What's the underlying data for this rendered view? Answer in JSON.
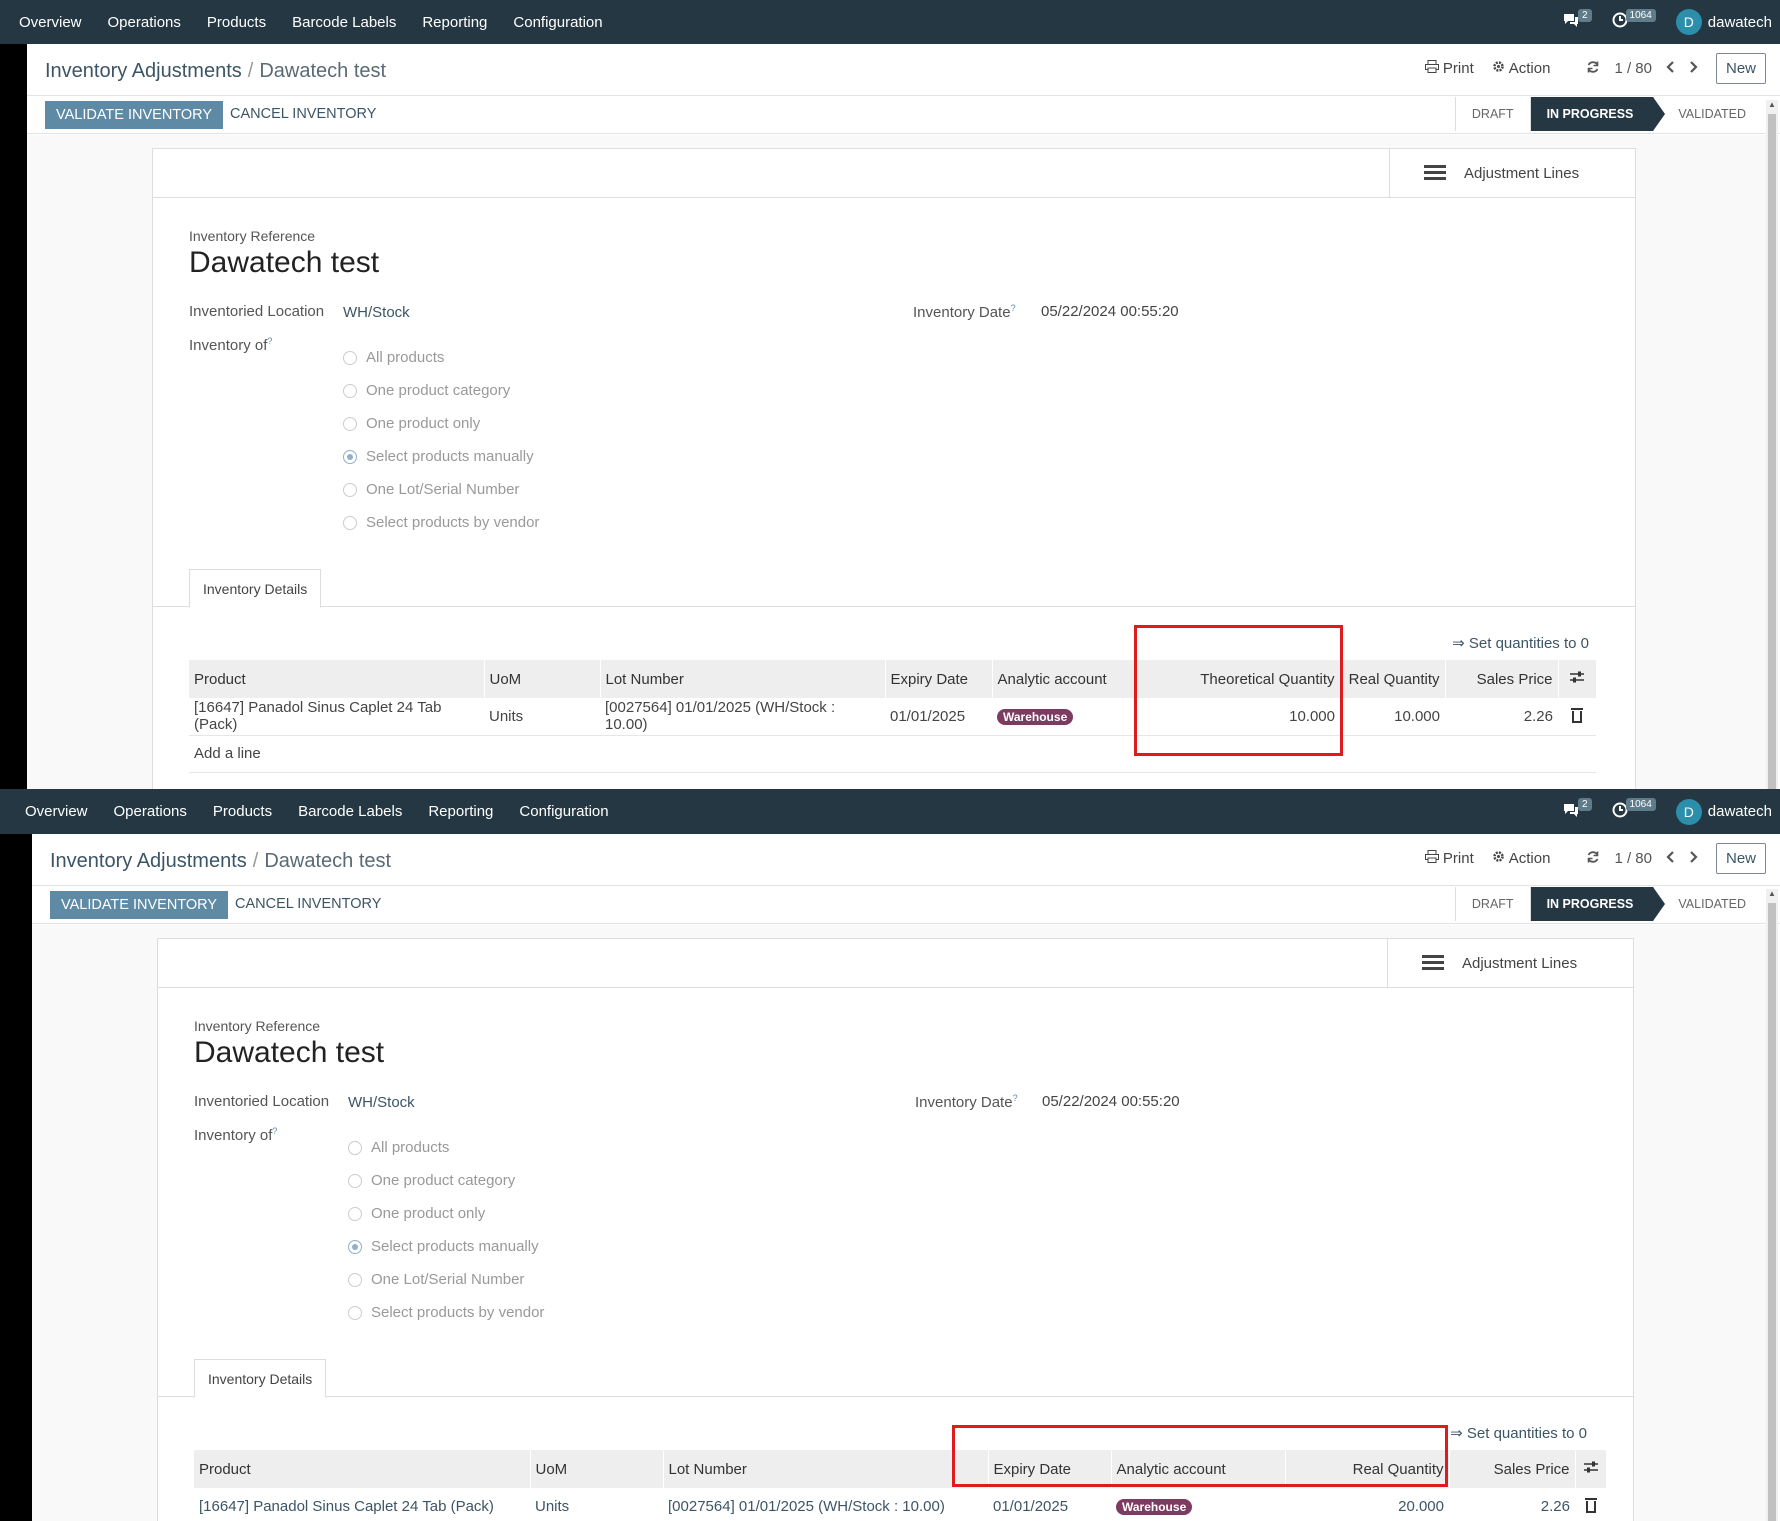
{
  "navbar": {
    "menu": [
      "Overview",
      "Operations",
      "Products",
      "Barcode Labels",
      "Reporting",
      "Configuration"
    ],
    "messages_count": "2",
    "activities_count": "1064",
    "user_initial": "D",
    "user_name": "dawatech"
  },
  "control_panel": {
    "breadcrumb_parent": "Inventory Adjustments",
    "breadcrumb_sep": "/",
    "breadcrumb_current": "Dawatech test",
    "print_label": "Print",
    "action_label": "Action",
    "pager": "1 / 80",
    "new_label": "New"
  },
  "statusbar": {
    "validate_label": "VALIDATE INVENTORY",
    "cancel_label": "CANCEL INVENTORY",
    "states": [
      "DRAFT",
      "IN PROGRESS",
      "VALIDATED"
    ],
    "active_state": "IN PROGRESS"
  },
  "form": {
    "smart_button": "Adjustment Lines",
    "reference_label": "Inventory Reference",
    "title": "Dawatech test",
    "location_label": "Inventoried Location",
    "location_value": "WH/Stock",
    "date_label": "Inventory Date",
    "date_help": "?",
    "date_value": "05/22/2024 00:55:20",
    "inventory_of_label": "Inventory of",
    "inventory_of_help": "?",
    "inventory_of_options": [
      "All products",
      "One product category",
      "One product only",
      "Select products manually",
      "One Lot/Serial Number",
      "Select products by vendor"
    ],
    "inventory_of_selected": "Select products manually",
    "tab_label": "Inventory Details",
    "set_quantities": "⇒ Set quantities to 0",
    "add_line": "Add a line"
  },
  "table_top": {
    "headers": [
      "Product",
      "UoM",
      "Lot Number",
      "Expiry Date",
      "Analytic account",
      "Theoretical Quantity",
      "Real Quantity",
      "Sales Price"
    ],
    "row": {
      "product": "[16647] Panadol Sinus Caplet 24 Tab (Pack)",
      "uom": "Units",
      "lot": "[0027564] 01/01/2025 (WH/Stock : 10.00)",
      "expiry": "01/01/2025",
      "analytic": "Warehouse",
      "theoretical_qty": "10.000",
      "real_qty": "10.000",
      "sales_price": "2.26"
    }
  },
  "table_bottom": {
    "headers": [
      "Product",
      "UoM",
      "Lot Number",
      "Expiry Date",
      "Analytic account",
      "Real Quantity",
      "Sales Price"
    ],
    "row": {
      "product": "[16647] Panadol Sinus Caplet 24 Tab (Pack)",
      "uom": "Units",
      "lot": "[0027564] 01/01/2025 (WH/Stock : 10.00)",
      "expiry": "01/01/2025",
      "analytic": "Warehouse",
      "real_qty": "20.000",
      "sales_price": "2.26"
    }
  },
  "colors": {
    "navbar": "#243742",
    "primary_button": "#5e8aa6",
    "status_active": "#243742",
    "analytic_tag": "#7e3b62",
    "highlight_box": "#e01b1b"
  }
}
